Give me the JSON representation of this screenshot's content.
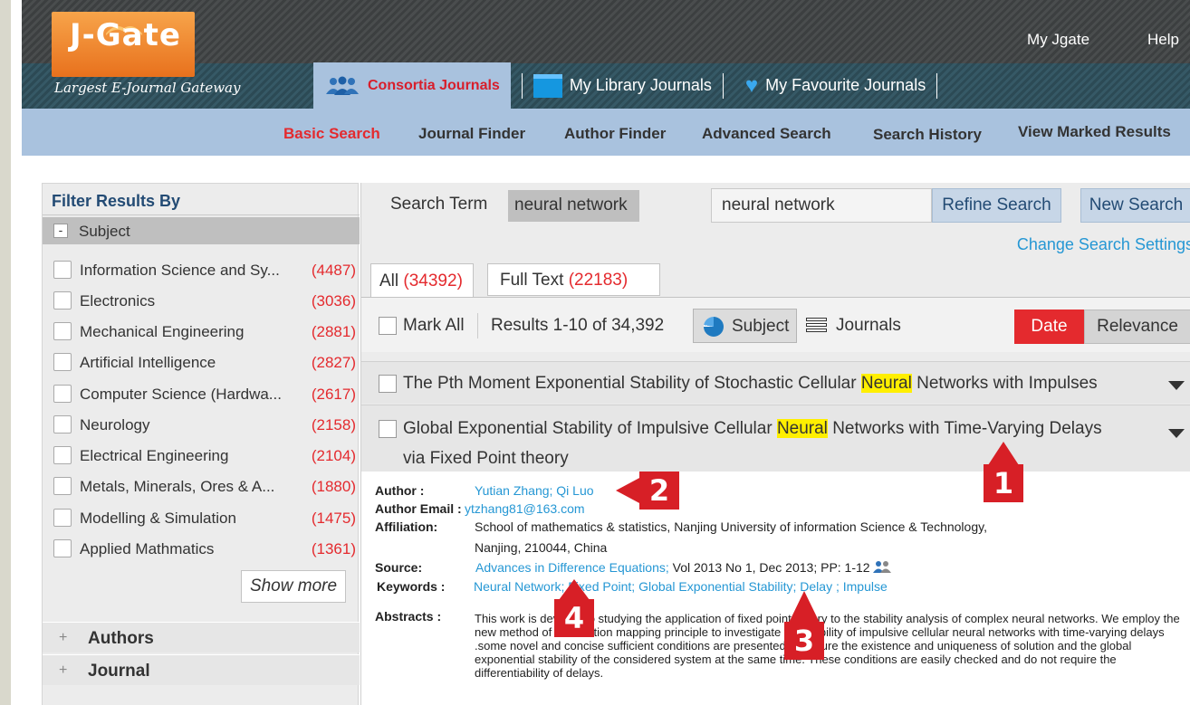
{
  "header": {
    "logo_text": "J-Gate",
    "tagline": "Largest E-Journal Gateway",
    "top_links": [
      "My Jgate",
      "Help"
    ],
    "journal_tabs": [
      {
        "label": "Consortia Journals",
        "icon": "users-icon",
        "active": true
      },
      {
        "label": "My Library Journals",
        "icon": "folder-icon",
        "active": false
      },
      {
        "label": "My Favourite Journals",
        "icon": "heart-icon",
        "active": false
      }
    ]
  },
  "nav": {
    "items": [
      "Basic Search",
      "Journal Finder",
      "Author Finder",
      "Advanced Search",
      "Search History",
      "View Marked Results"
    ],
    "active": "Basic Search"
  },
  "sidebar": {
    "title": "Filter Results By",
    "subject_section": "Subject",
    "subjects": [
      {
        "label": "Information  Science and Sy...",
        "count": "(4487)"
      },
      {
        "label": "Electronics",
        "count": "(3036)"
      },
      {
        "label": "Mechanical Engineering",
        "count": "(2881)"
      },
      {
        "label": "Artificial Intelligence",
        "count": "(2827)"
      },
      {
        "label": "Computer Science (Hardwa...",
        "count": "(2617)"
      },
      {
        "label": "Neurology",
        "count": "(2158)"
      },
      {
        "label": "Electrical Engineering",
        "count": "(2104)"
      },
      {
        "label": "Metals, Minerals, Ores & A...",
        "count": "(1880)"
      },
      {
        "label": "Modelling & Simulation",
        "count": "(1475)"
      },
      {
        "label": "Applied Mathmatics",
        "count": "(1361)"
      }
    ],
    "show_more": "Show more",
    "collapsed_sections": [
      "Authors",
      "Journal"
    ]
  },
  "search": {
    "term_label": "Search Term",
    "term": "neural network",
    "input_value": "neural network",
    "refine_label": "Refine Search",
    "new_label": "New Search",
    "change_settings": "Change Search Settings"
  },
  "tabs": {
    "all_label": "All",
    "all_count": "(34392)",
    "full_label": "Full Text",
    "full_count": "(22183)"
  },
  "toolbar": {
    "mark_all": "Mark All",
    "results_text": "Results 1-10 of 34,392",
    "subject_btn": "Subject",
    "journals_label": "Journals",
    "sort_date": "Date",
    "sort_relevance": "Relevance"
  },
  "results": [
    {
      "title_pre": "The Pth Moment Exponential Stability of Stochastic Cellular ",
      "highlight": "Neural",
      "title_post": " Networks with Impulses"
    },
    {
      "title_pre": "Global Exponential Stability of Impulsive Cellular ",
      "highlight": "Neural",
      "title_post": " Networks with Time-Varying Delays",
      "title_line2": "via Fixed Point theory"
    }
  ],
  "detail": {
    "author_label": "Author :",
    "authors": "Yutian Zhang; Qi Luo",
    "email_label": "Author Email :",
    "email": "ytzhang81@163.com",
    "affiliation_label": "Affiliation:",
    "affiliation_line1": "School of mathematics & statistics, Nanjing University of information Science & Technology,",
    "affiliation_line2": "Nanjing, 210044, China",
    "source_label": "Source:",
    "source_journal": "Advances in Difference Equations;",
    "source_rest": " Vol 2013 No 1, Dec 2013; PP: 1-12",
    "keywords_label": "Keywords :",
    "keywords": "Neural Network; Fixed Point; Global Exponential Stability; Delay ; Impulse",
    "abstract_label": "Abstracts :",
    "abstract": "This work is devoted to studying the application of fixed point theory to the stability analysis of complex neural networks. We employ the new method of contraction mapping principle to investigate  the stability of impulsive cellular neural networks with time-varying delays .some novel and concise sufficient conditions are presented to ensure the existence and uniqueness of solution and the global exponential stability of the considered system at the same time. These conditions are easily checked and do not require the differentiability of delays."
  },
  "badges": [
    "1",
    "2",
    "3",
    "4"
  ],
  "colors": {
    "accent_red": "#e42a2e",
    "link_blue": "#2597d4",
    "nav_blue": "#a9c2de",
    "highlight_yellow": "#ffef00",
    "badge_red": "#d71f26"
  }
}
